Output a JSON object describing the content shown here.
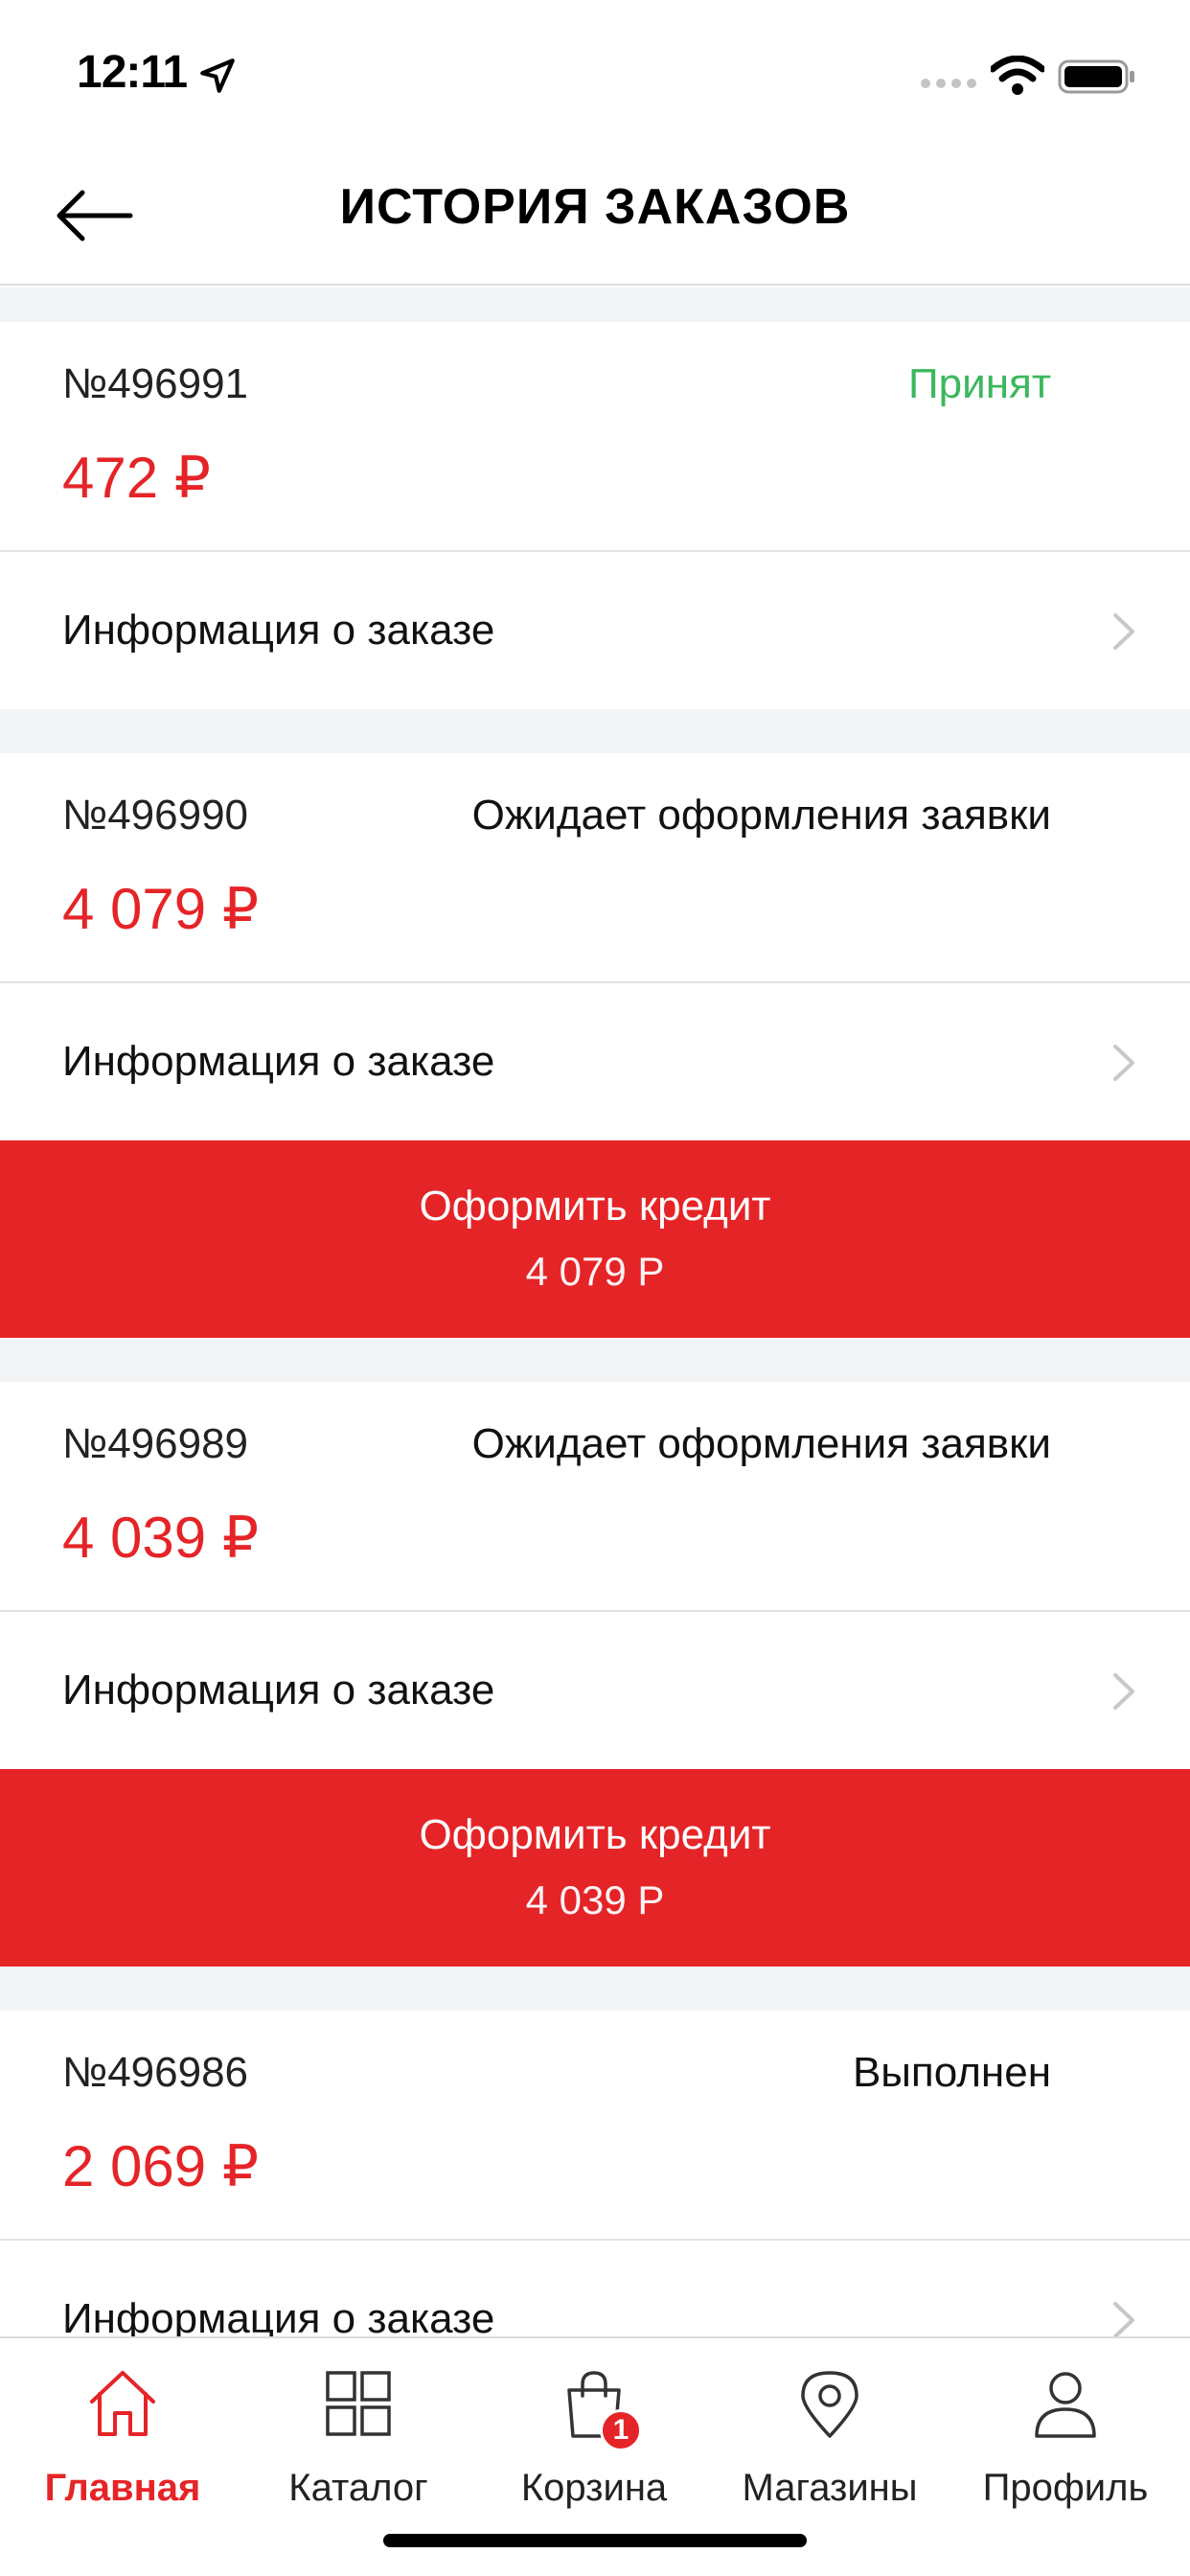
{
  "status_bar": {
    "time": "12:11"
  },
  "header": {
    "title": "ИСТОРИЯ ЗАКАЗОВ"
  },
  "orders": [
    {
      "number": "№496991",
      "status": "Принят",
      "status_color": "#3bb85c",
      "price": "472 ₽",
      "info_label": "Информация о заказе"
    },
    {
      "number": "№496990",
      "status": "Ожидает оформления заявки",
      "price": "4 079 ₽",
      "info_label": "Информация о заказе",
      "credit_label": "Оформить кредит",
      "credit_amount": "4 079 Р"
    },
    {
      "number": "№496989",
      "status": "Ожидает оформления заявки",
      "price": "4 039 ₽",
      "info_label": "Информация о заказе",
      "credit_label": "Оформить кредит",
      "credit_amount": "4 039 Р"
    },
    {
      "number": "№496986",
      "status": "Выполнен",
      "price": "2 069 ₽",
      "info_label": "Информация о заказе"
    }
  ],
  "tab_bar": {
    "items": [
      {
        "label": "Главная",
        "icon": "home-icon",
        "active": true
      },
      {
        "label": "Каталог",
        "icon": "grid-icon"
      },
      {
        "label": "Корзина",
        "icon": "bag-icon",
        "badge": "1"
      },
      {
        "label": "Магазины",
        "icon": "location-pin-icon"
      },
      {
        "label": "Профиль",
        "icon": "user-icon"
      }
    ]
  },
  "colors": {
    "accent": "#e52427",
    "status_accepted": "#3bb85c"
  }
}
